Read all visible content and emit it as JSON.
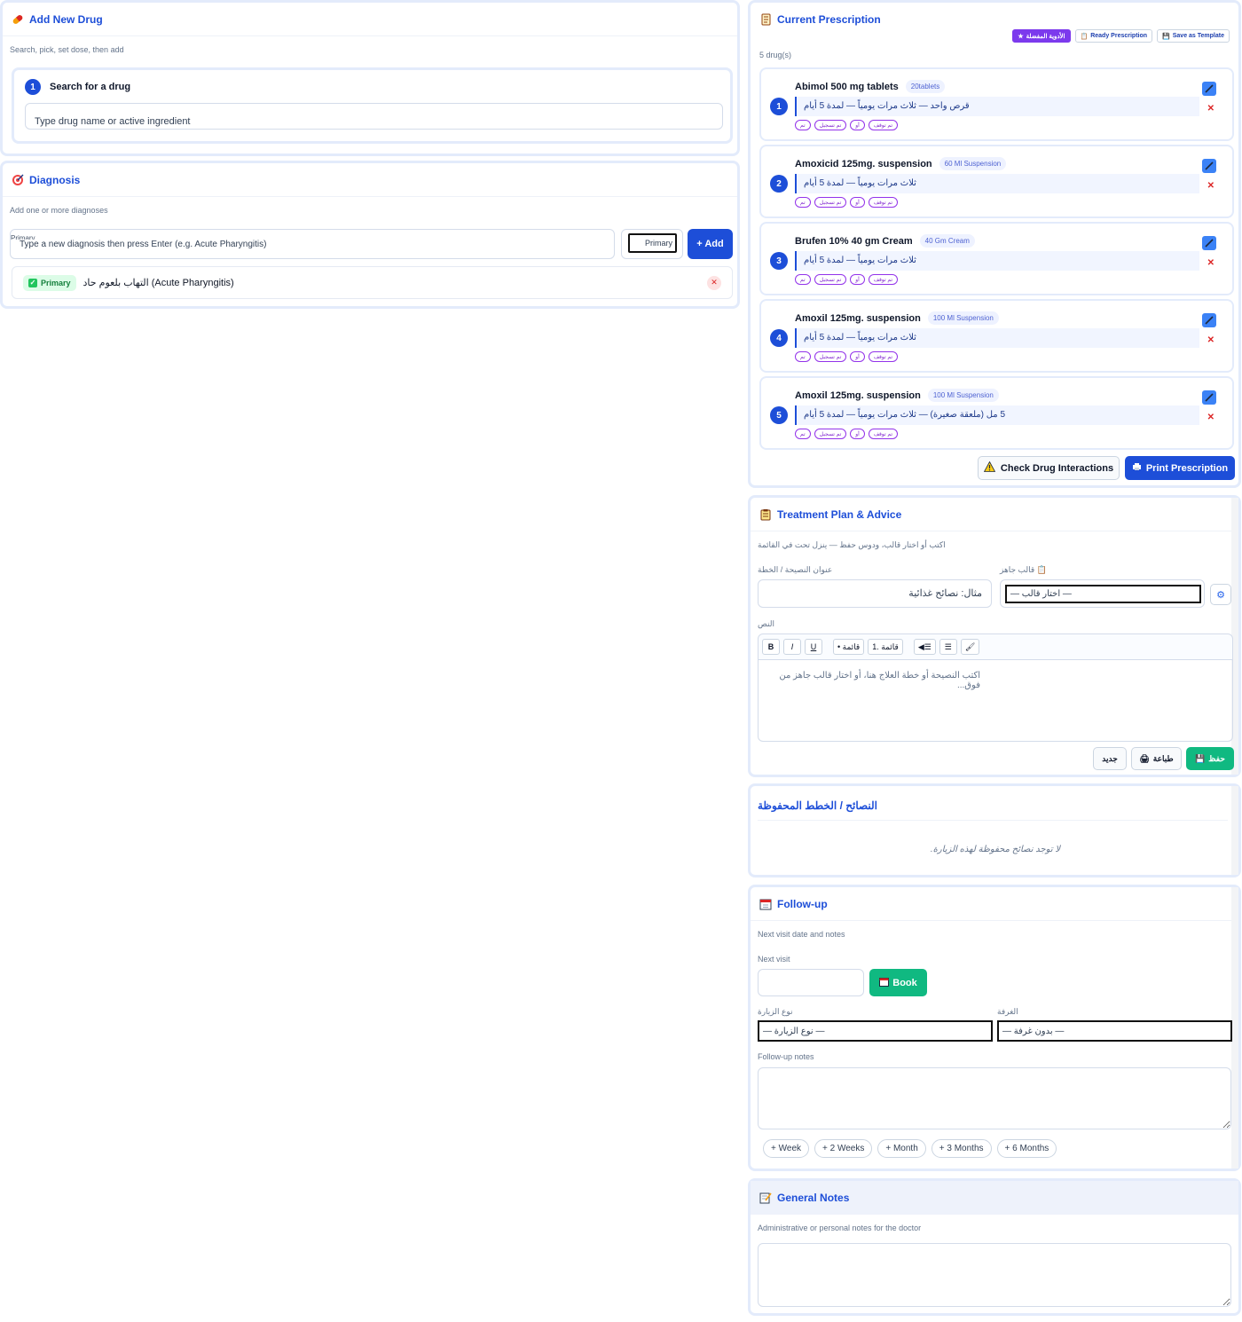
{
  "drug_panel": {
    "title": "Add New Drug",
    "subtitle": "Search, pick, set dose, then add",
    "step_number": "1",
    "step_label": "Search for a drug",
    "search_placeholder": "Type drug name or active ingredient"
  },
  "diagnosis": {
    "title": "Diagnosis",
    "subtitle": "Add one or more diagnoses",
    "ghost_label": "Primary",
    "input_placeholder": "Type a new diagnosis then press Enter (e.g. Acute Pharyngitis)",
    "type_selected": "Primary",
    "add_label": "+ Add",
    "items": [
      {
        "badge": "Primary",
        "text": "التهاب بلعوم حاد (Acute Pharyngitis)"
      }
    ]
  },
  "prescription": {
    "title": "Current Prescription",
    "favorites_label": "الأدوية المفضلة",
    "ready_label": "Ready Prescription",
    "template_label": "Save as Template",
    "count_text": "5 drug(s)",
    "drugs": [
      {
        "num": "1",
        "name": "Abimol 500 mg tablets",
        "pack": "20tablets",
        "dose": "قرص واحد — ثلاث مرات يومياً — لمدة 5 أيام"
      },
      {
        "num": "2",
        "name": "Amoxicid 125mg. suspension",
        "pack": "60 Ml Suspension",
        "dose": "ثلاث مرات يومياً — لمدة 5 أيام"
      },
      {
        "num": "3",
        "name": "Brufen 10% 40 gm Cream",
        "pack": "40 Gm Cream",
        "dose": "ثلاث مرات يومياً — لمدة 5 أيام"
      },
      {
        "num": "4",
        "name": "Amoxil 125mg. suspension",
        "pack": "100 Ml Suspension",
        "dose": "ثلاث مرات يومياً — لمدة 5 أيام"
      },
      {
        "num": "5",
        "name": "Amoxil 125mg. suspension",
        "pack": "100 Ml Suspension",
        "dose": "5 مل (ملعقة صغيرة) — ثلاث مرات يومياً — لمدة 5 أيام"
      }
    ],
    "timing_tags": [
      "تم",
      "تم تسجيل",
      "أو",
      "تم توقف"
    ],
    "check_label": "Check Drug Interactions",
    "print_label": "Print Prescription"
  },
  "plan": {
    "title": "Treatment Plan & Advice",
    "subtitle": "اكتب أو اختار قالب، ودوس حفظ — ينزل تحت في القائمة",
    "title_label": "عنوان النصيحة / الخطة",
    "title_placeholder": "مثال: نصائح غذائية",
    "template_label": "قالب جاهز",
    "template_selected": "— اختار قالب —",
    "text_label": "النص",
    "toolbar": [
      "B",
      "I",
      "U",
      "• قائمة",
      "1. قائمة",
      "◀☰",
      "☰",
      "🖌"
    ],
    "editor_placeholder": "اكتب النصيحة أو خطة العلاج هنا، أو اختار قالب جاهز من فوق...",
    "save_label": "حفظ",
    "print_label": "طباعة",
    "new_label": "جديد"
  },
  "saved": {
    "title": "النصائح / الخطط المحفوظة",
    "empty_text": "لا توجد نصائح محفوظة لهذه الزيارة."
  },
  "followup": {
    "title": "Follow-up",
    "subtitle": "Next visit date and notes",
    "next_visit_label": "Next visit",
    "book_label": "Book",
    "visit_type_label": "نوع الزيارة",
    "visit_type_selected": "— نوع الزيارة —",
    "room_label": "الغرفة",
    "room_selected": "— بدون غرفة —",
    "notes_label": "Follow-up notes",
    "quick": [
      "+ Week",
      "+ 2 Weeks",
      "+ Month",
      "+ 3 Months",
      "+ 6 Months"
    ]
  },
  "general_notes": {
    "title": "General Notes",
    "subtitle": "Administrative or personal notes for the doctor"
  },
  "colors": {
    "primary": "#1d4ed8",
    "success": "#10b981",
    "favorite": "#7c3aed",
    "danger": "#dc2626",
    "card_border": "#e3ebfb"
  }
}
